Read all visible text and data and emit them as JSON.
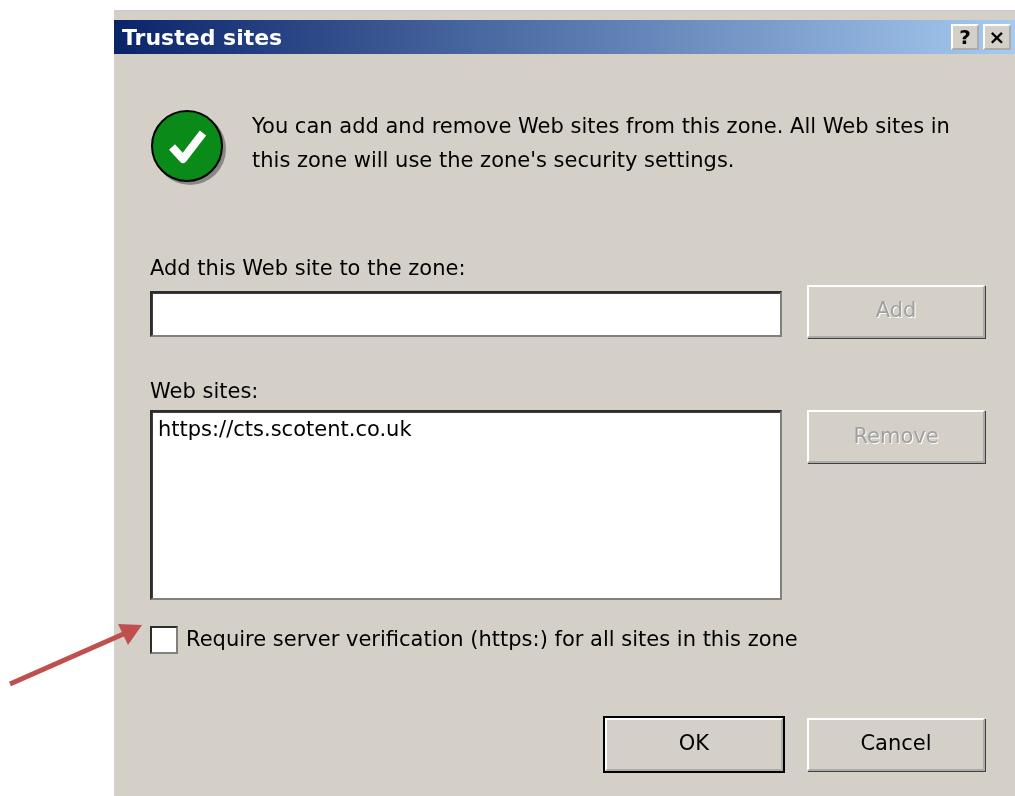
{
  "window": {
    "title": "Trusted sites",
    "title_buttons": [
      {
        "label": "?"
      },
      {
        "label": "×"
      }
    ]
  },
  "message": "You can add and remove Web sites from this zone. All Web sites in this zone will use the zone's security settings.",
  "add_field": {
    "label": "Add this Web site to the zone:"
  },
  "add_button": {
    "label": "Add",
    "disabled": true
  },
  "websites": {
    "label": "Web sites:",
    "items": [
      "https://cts.scotent.co.uk"
    ]
  },
  "remove_button": {
    "label": "Remove",
    "disabled": true
  },
  "checkbox": {
    "label": "Require server verification (https:) for all sites in this zone",
    "checked": false
  },
  "buttons": [
    {
      "label": "OK",
      "default": true
    },
    {
      "label": "Cancel",
      "default": false
    }
  ]
}
